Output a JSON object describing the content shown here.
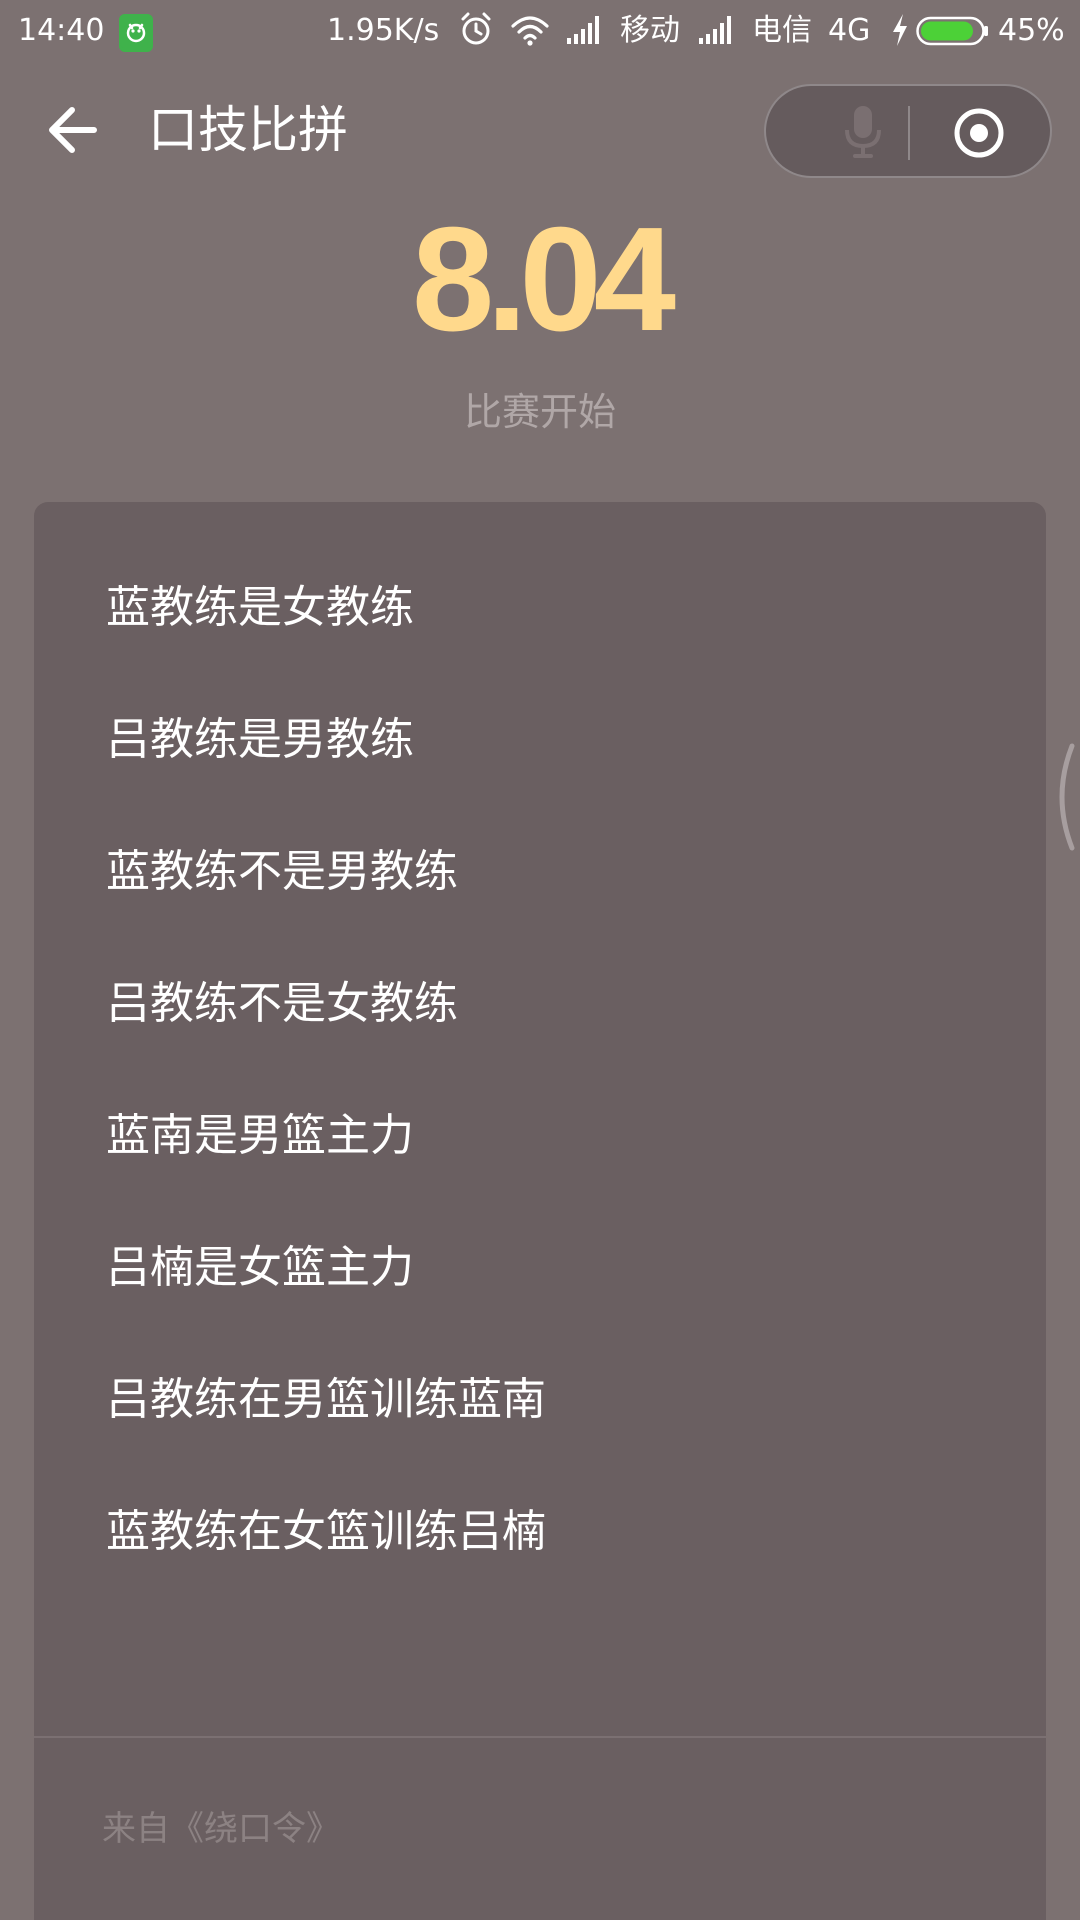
{
  "status_bar": {
    "time": "14:40",
    "speed": "1.95K/s",
    "carrier1": "移动",
    "carrier2": "电信",
    "network": "4G",
    "battery": "45%",
    "battery_level": 0.45,
    "icons": [
      "app-notification-icon",
      "alarm-icon",
      "wifi-icon",
      "signal-icon",
      "signal-icon",
      "charging-icon",
      "battery-icon"
    ]
  },
  "header": {
    "title": "口技比拼",
    "back_icon": "back-arrow-icon",
    "capsule_icons": [
      "microphone-icon",
      "record-icon"
    ]
  },
  "score": {
    "value": "8.04",
    "status": "比赛开始"
  },
  "tongue_twister": {
    "lines": [
      "蓝教练是女教练",
      "吕教练是男教练",
      "蓝教练不是男教练",
      "吕教练不是女教练",
      "蓝南是男篮主力",
      "吕楠是女篮主力",
      "吕教练在男篮训练蓝南",
      "蓝教练在女篮训练吕楠"
    ],
    "source": "来自《绕口令》"
  },
  "colors": {
    "background": "#7c7171",
    "card": "#6a5f61",
    "score": "#ffd98c",
    "battery_fill": "#4cd137"
  }
}
